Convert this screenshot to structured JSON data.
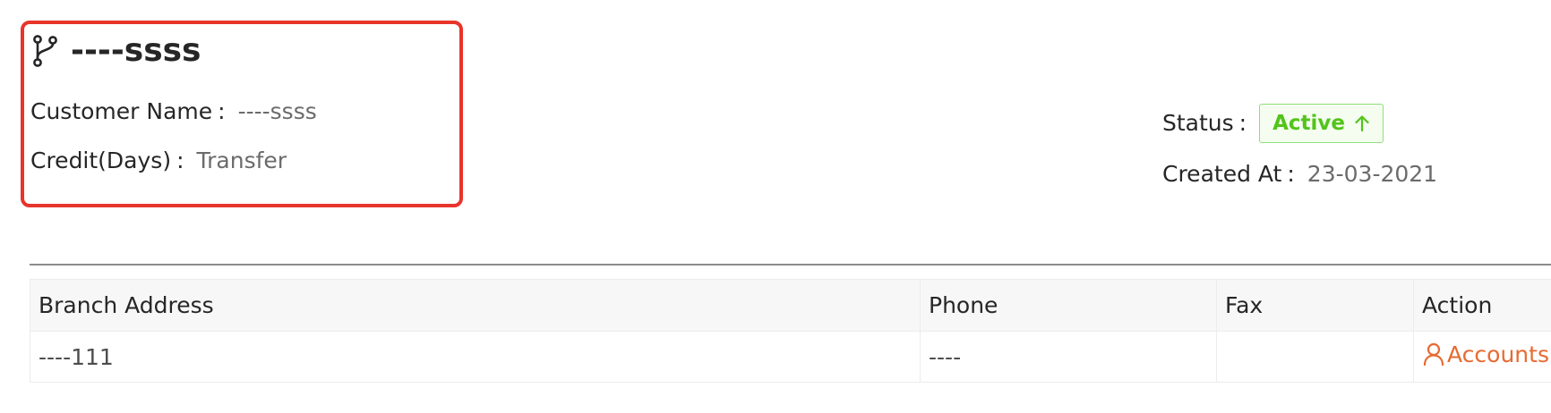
{
  "header": {
    "branch_name": "----ssss",
    "branch_icon": "git-branch-icon"
  },
  "details": {
    "customer_name_label": "Customer Name",
    "customer_name_value": "----ssss",
    "credit_label": "Credit(Days)",
    "credit_value": "Transfer",
    "status_label": "Status",
    "status_value": "Active",
    "created_at_label": "Created At",
    "created_at_value": "23-03-2021",
    "colon": ":"
  },
  "table": {
    "columns": [
      "Branch Address",
      "Phone",
      "Fax",
      "Action"
    ],
    "rows": [
      {
        "address": "----111",
        "phone": "----",
        "fax": "",
        "action_label": "Accounts",
        "action_icon": "user-icon"
      }
    ]
  },
  "colors": {
    "highlight": "#e8342b",
    "status_active": "#52c41a",
    "action_link": "#e76a32"
  }
}
